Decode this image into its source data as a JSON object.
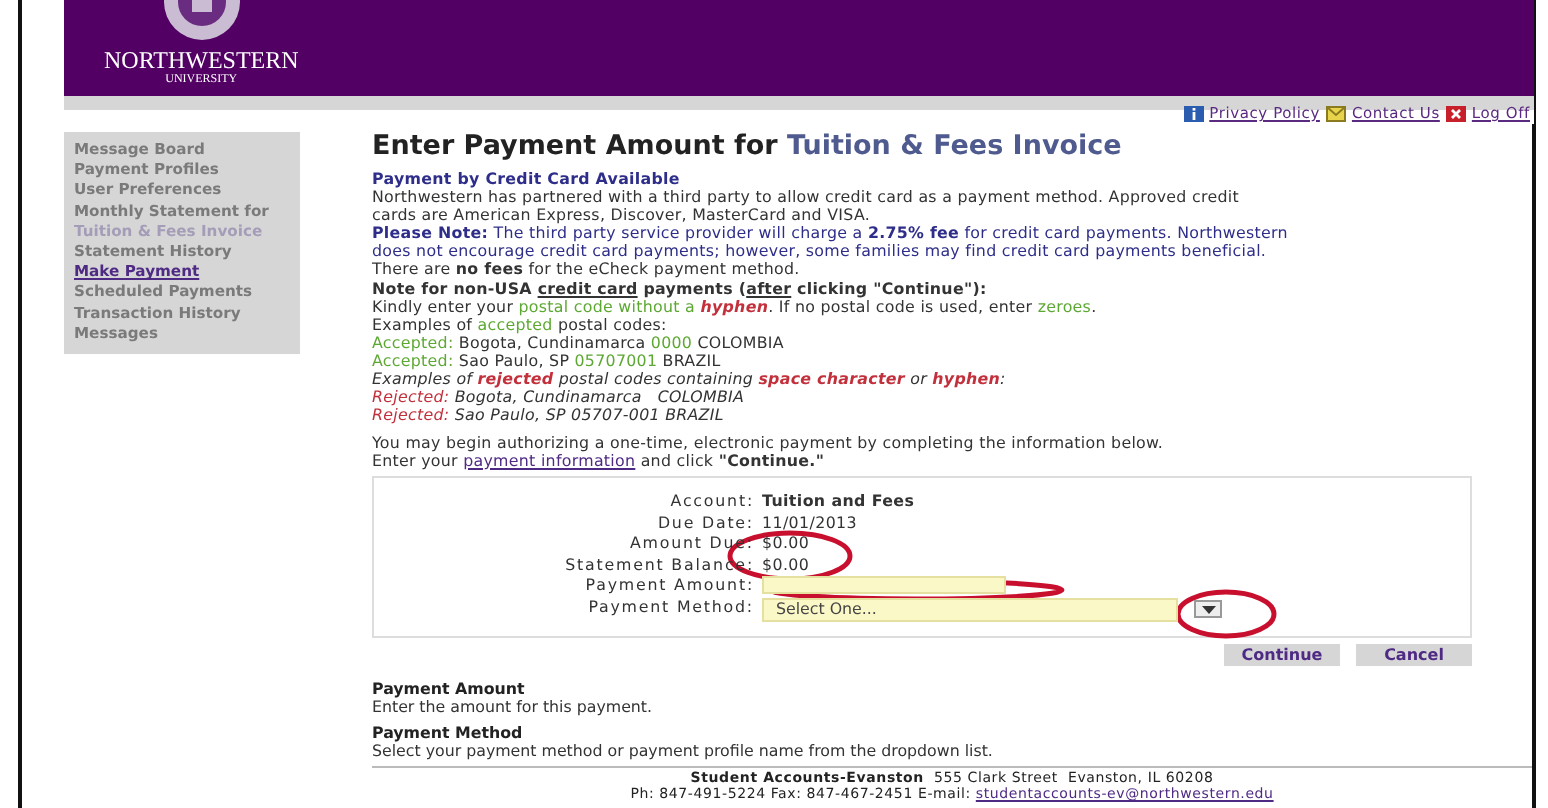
{
  "header": {
    "logo_name": "NORTHWESTERN",
    "logo_sub": "UNIVERSITY"
  },
  "top_links": [
    "Privacy Policy",
    "Contact Us",
    "Log Off"
  ],
  "sidebar": {
    "items": [
      {
        "label": "Message Board",
        "selected": false
      },
      {
        "label": "Payment Profiles",
        "selected": false
      },
      {
        "label": "User Preferences",
        "selected": false
      },
      {
        "label": "Monthly Statement for",
        "sublabel": "Tuition & Fees Invoice",
        "selected": false
      },
      {
        "label": "Statement History",
        "selected": false
      },
      {
        "label": "Make Payment",
        "selected": true
      },
      {
        "label": "Scheduled Payments",
        "selected": false
      },
      {
        "label": "Transaction History",
        "selected": false
      },
      {
        "label": "Messages",
        "selected": false
      }
    ]
  },
  "page_title": {
    "prefix": "Enter Payment Amount for",
    "subject": "Tuition & Fees Invoice"
  },
  "info_blocks": [
    [
      [
        {
          "text": "Payment by Credit Card Available",
          "kind": "notice-heading"
        }
      ],
      [
        {
          "text": "Northwestern has partnered with a third party to allow credit card as a payment method. Approved credit",
          "kind": "plain"
        }
      ],
      [
        {
          "text": "cards are American Express, Discover, MasterCard and VISA.",
          "kind": "plain"
        }
      ],
      [
        {
          "text": "Please Note:",
          "kind": "notice-heading"
        },
        {
          "text": " The third party service provider will charge a ",
          "kind": "notice"
        },
        {
          "text": "2.75% fee",
          "kind": "notice-heading"
        },
        {
          "text": " for credit card payments. Northwestern",
          "kind": "notice"
        }
      ],
      [
        {
          "text": "does not encourage credit card payments; however, some families may find credit card payments beneficial.",
          "kind": "notice"
        }
      ],
      [
        {
          "text": "There are ",
          "kind": "plain"
        },
        {
          "text": "no fees",
          "kind": "strong"
        },
        {
          "text": " for the eCheck payment method.",
          "kind": "plain"
        }
      ]
    ],
    [
      [
        {
          "text": "Note for non-USA ",
          "kind": "strong"
        },
        {
          "text": "credit card",
          "kind": "strong-underlined"
        },
        {
          "text": " payments (",
          "kind": "strong"
        },
        {
          "text": "after",
          "kind": "strong-underlined"
        },
        {
          "text": " clicking \"Continue\"):",
          "kind": "strong"
        }
      ],
      [
        {
          "text": "Kindly enter your ",
          "kind": "plain"
        },
        {
          "text": "postal code without a ",
          "kind": "accepted"
        },
        {
          "text": "hyphen",
          "kind": "rejected-strong"
        },
        {
          "text": ". If no postal code is used, enter ",
          "kind": "plain"
        },
        {
          "text": "zeroes",
          "kind": "accepted"
        },
        {
          "text": ".",
          "kind": "plain"
        }
      ],
      [
        {
          "text": "Examples of ",
          "kind": "plain"
        },
        {
          "text": "accepted",
          "kind": "accepted"
        },
        {
          "text": " postal codes:",
          "kind": "plain"
        }
      ],
      [
        {
          "text": "Accepted:",
          "kind": "accepted"
        },
        {
          "text": " Bogota, Cundinamarca ",
          "kind": "plain"
        },
        {
          "text": "0000",
          "kind": "accepted"
        },
        {
          "text": " COLOMBIA",
          "kind": "plain"
        }
      ],
      [
        {
          "text": "Accepted:",
          "kind": "accepted"
        },
        {
          "text": " Sao Paulo, SP ",
          "kind": "plain"
        },
        {
          "text": "05707001",
          "kind": "accepted"
        },
        {
          "text": " BRAZIL",
          "kind": "plain"
        }
      ],
      [
        {
          "text": "Examples of ",
          "kind": "example"
        },
        {
          "text": "rejected",
          "kind": "rejected-strong"
        },
        {
          "text": " postal codes containing ",
          "kind": "example"
        },
        {
          "text": "space character",
          "kind": "rejected-strong"
        },
        {
          "text": " or ",
          "kind": "example"
        },
        {
          "text": "hyphen",
          "kind": "rejected-strong"
        },
        {
          "text": ":",
          "kind": "example"
        }
      ],
      [
        {
          "text": "Rejected:",
          "kind": "rejected"
        },
        {
          "text": " Bogota, Cundinamarca   COLOMBIA",
          "kind": "example"
        }
      ],
      [
        {
          "text": "Rejected:",
          "kind": "rejected"
        },
        {
          "text": " Sao Paulo, SP 05707-001 BRAZIL",
          "kind": "example"
        }
      ]
    ],
    [
      [
        {
          "text": "You may begin authorizing a one-time, electronic payment by completing the information below.",
          "kind": "plain"
        }
      ],
      [
        {
          "text": "Enter your ",
          "kind": "plain"
        },
        {
          "text": "payment information",
          "kind": "link"
        },
        {
          "text": " and click ",
          "kind": "plain"
        },
        {
          "text": "\"Continue.\"",
          "kind": "strong"
        }
      ]
    ]
  ],
  "form": {
    "fields": [
      {
        "label": "Account:",
        "kind": "strong-text",
        "value": "Tuition and Fees"
      },
      {
        "label": "Due Date:",
        "kind": "text",
        "value": "11/01/2013"
      },
      {
        "label": "Amount Due:",
        "kind": "text",
        "value": "$0.00"
      },
      {
        "label": "Statement Balance:",
        "kind": "text",
        "value": "$0.00"
      },
      {
        "label": "Payment Amount:",
        "kind": "input"
      },
      {
        "label": "Payment Method:",
        "kind": "select",
        "value": "Select One..."
      }
    ]
  },
  "buttons": [
    "Continue",
    "Cancel"
  ],
  "help": [
    {
      "title": "Payment Amount",
      "text": "Enter the amount for this payment."
    },
    {
      "title": "Payment Method",
      "text": "Select your payment method or payment profile name from the dropdown list."
    }
  ],
  "footer": [
    [
      {
        "text": "Student Accounts-Evanston",
        "kind": "strong"
      },
      {
        "text": "  555 Clark Street  Evanston, IL 60208",
        "kind": "plain"
      }
    ],
    [
      {
        "text": "Ph: 847-491-5224 Fax: 847-467-2451 E-mail: ",
        "kind": "plain"
      },
      {
        "text": "studentaccounts-ev@northwestern.edu",
        "kind": "link"
      }
    ]
  ]
}
